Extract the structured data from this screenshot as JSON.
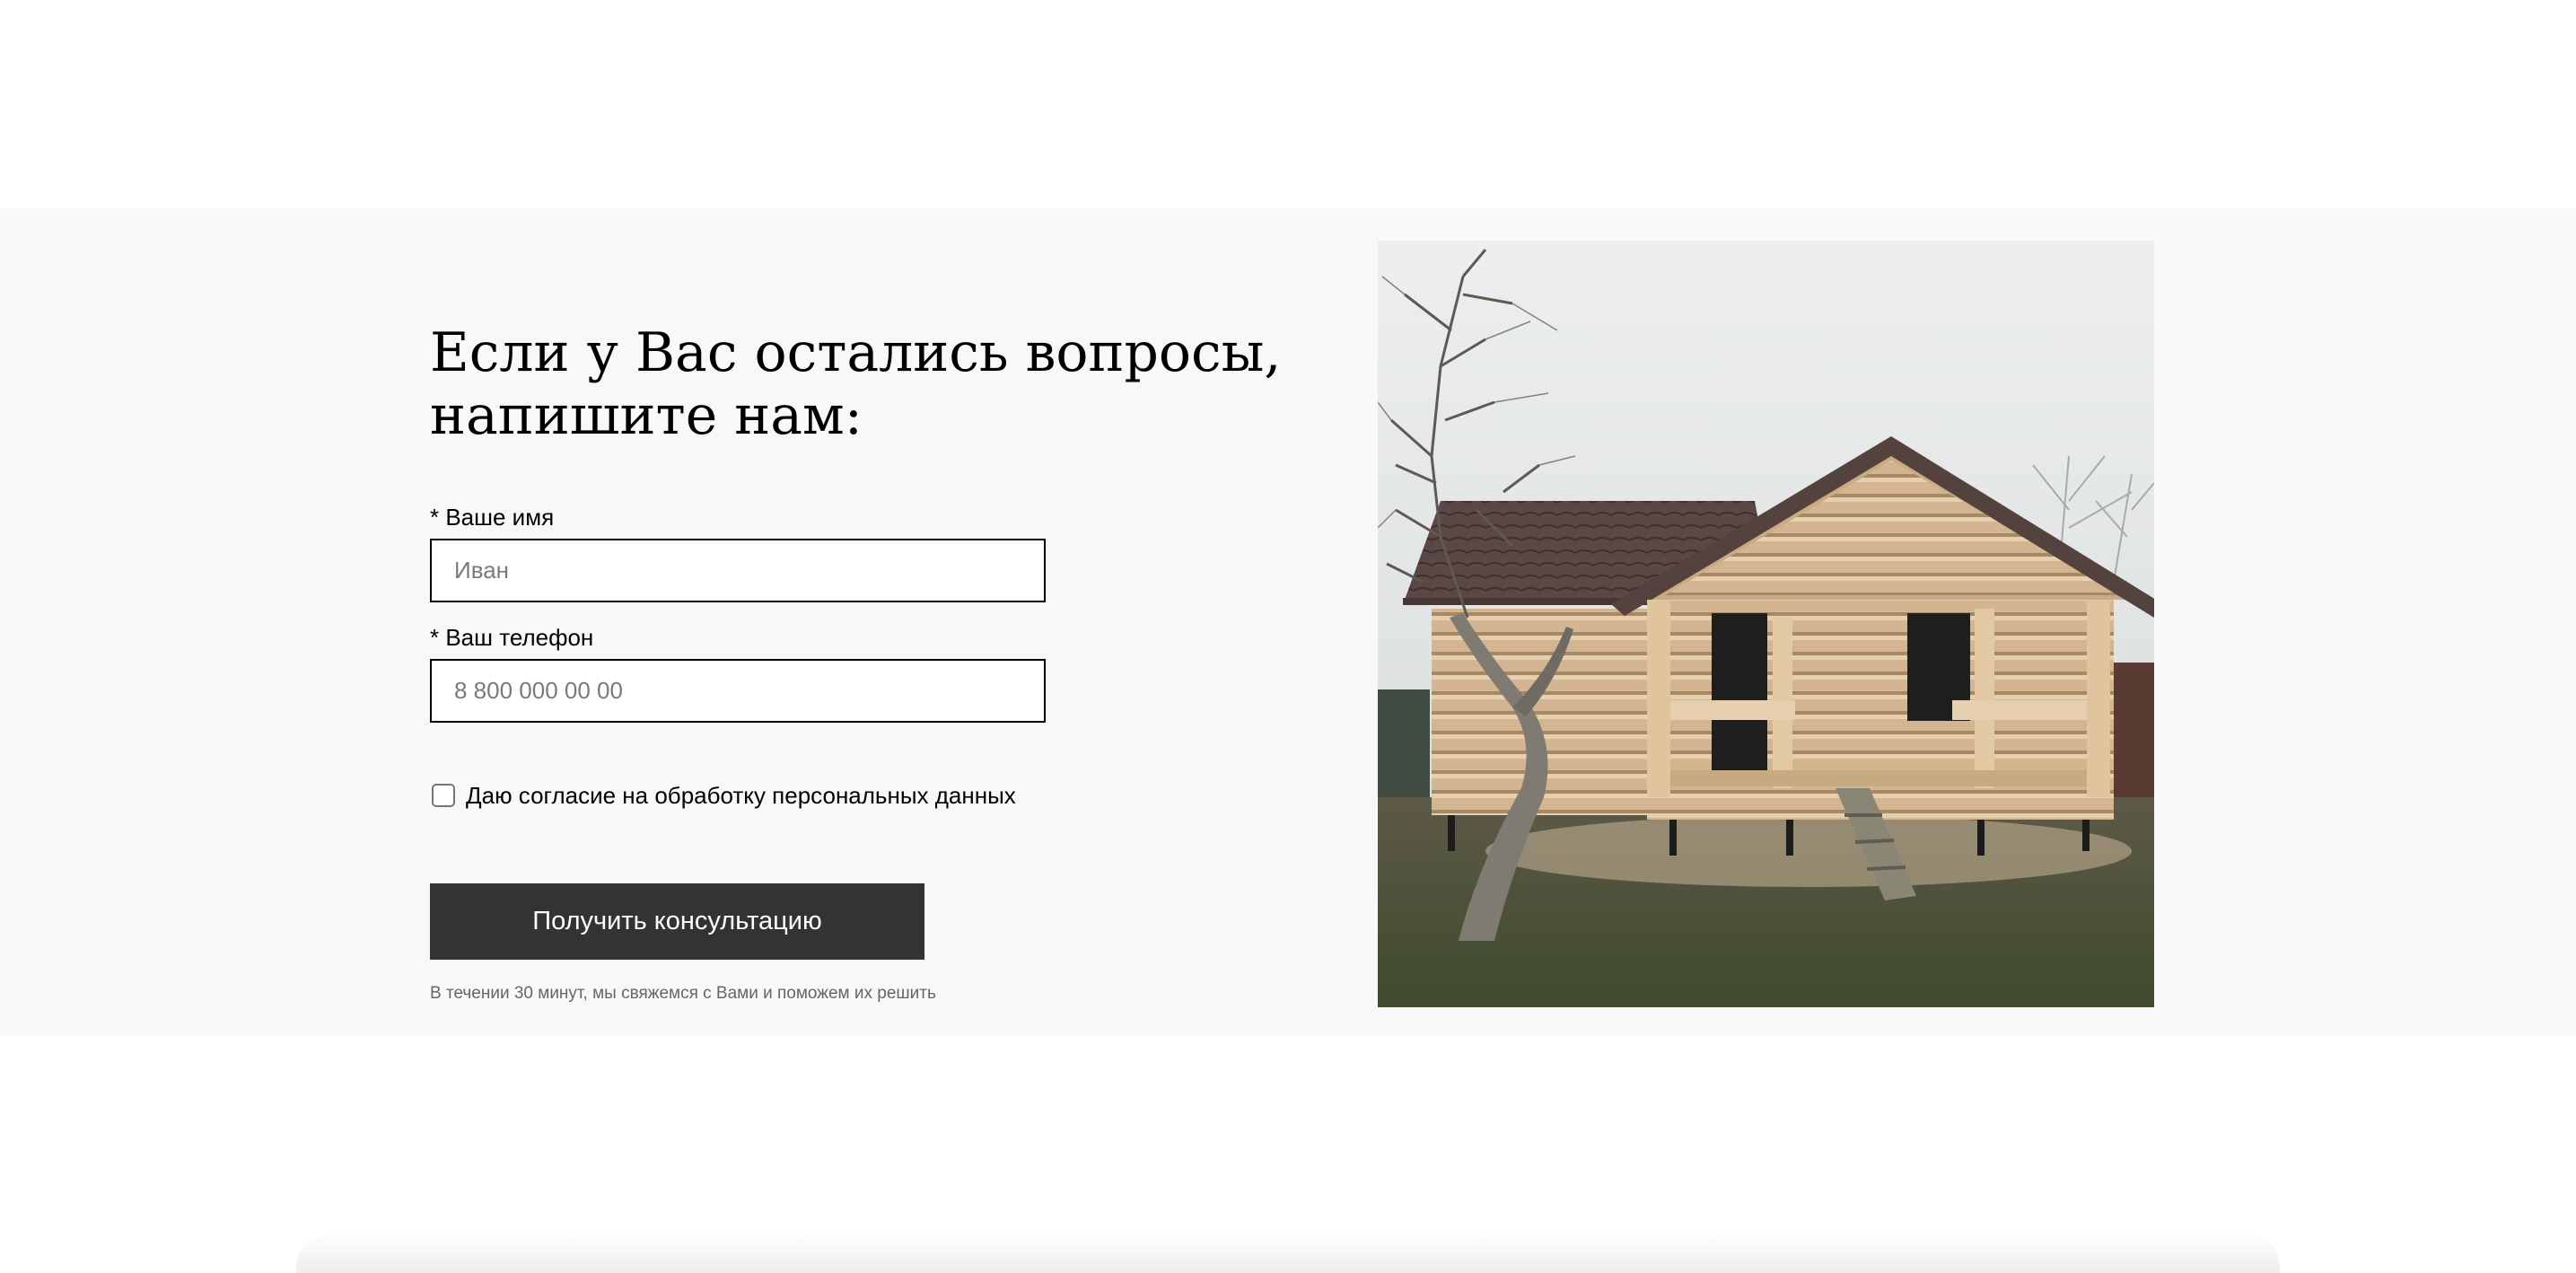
{
  "contact_form": {
    "heading_line1": "Если у Вас остались вопросы,",
    "heading_line2": "напишите нам:",
    "name_label": "* Ваше имя",
    "name_placeholder": "Иван",
    "name_value": "",
    "phone_label": "* Ваш телефон",
    "phone_placeholder": "8 800 000 00 00",
    "phone_value": "",
    "consent_label": "Даю согласие на обработку персональных данных",
    "consent_checked": false,
    "submit_label": "Получить консультацию",
    "note": "В течении 30 минут, мы свяжемся с Вами и поможем их решить"
  },
  "photo": {
    "subject": "log-house"
  },
  "colors": {
    "section_background": "#f8f8f8",
    "button_background": "#333333",
    "button_text": "#ffffff",
    "note_text": "#666666"
  }
}
